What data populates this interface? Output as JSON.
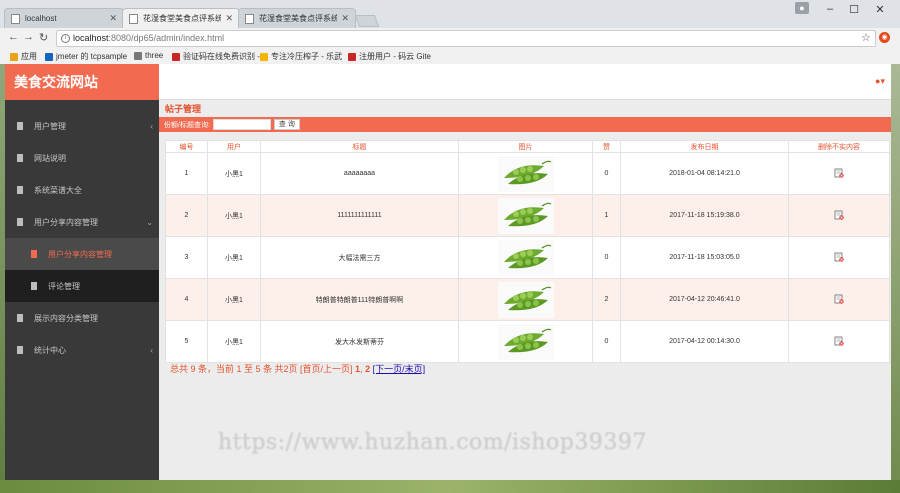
{
  "browser": {
    "tabs": [
      {
        "title": "localhost",
        "active": false
      },
      {
        "title": "花湿食堂美食点评系统",
        "active": true
      },
      {
        "title": "花湿食堂美食点评系统",
        "active": false
      }
    ],
    "url_host": "localhost",
    "url_path": ":8080/dp65/admin/index.html",
    "bookmarks": [
      "应用",
      "jmeter 的 tcpsample",
      "three",
      "验证码在线免费识别 -",
      "专注冷压榨子 - 乐武",
      "注册用户 - 码云 Gite"
    ],
    "bookmark_colors": [
      "#e8a317",
      "#1565c0",
      "#777777",
      "#c62828",
      "#f5b400",
      "#c62828"
    ]
  },
  "app": {
    "brand": "美食交流网站",
    "accent": "#f26b50",
    "sidebar": [
      {
        "label": "用户管理",
        "caret": "‹",
        "sub": false,
        "active": false
      },
      {
        "label": "网站说明",
        "caret": "",
        "sub": false,
        "active": false
      },
      {
        "label": "系统菜谱大全",
        "caret": "",
        "sub": false,
        "active": false
      },
      {
        "label": "用户分享内容管理",
        "caret": "⌄",
        "sub": false,
        "active": false
      },
      {
        "label": "用户分享内容管理",
        "caret": "",
        "sub": true,
        "active": true
      },
      {
        "label": "评论管理",
        "caret": "",
        "sub": true,
        "active": false
      },
      {
        "label": "展示内容分类管理",
        "caret": "",
        "sub": false,
        "active": false
      },
      {
        "label": "统计中心",
        "caret": "‹",
        "sub": false,
        "active": false
      }
    ],
    "section_title": "帖子管理",
    "search": {
      "label": "份额/标题查询:",
      "value": "",
      "button": "查 询"
    },
    "table": {
      "headers": [
        "编号",
        "用户",
        "标题",
        "图片",
        "赞",
        "发布日期",
        "删除不实内容"
      ],
      "rows": [
        {
          "id": "1",
          "user": "小黑1",
          "title": "aaaaaaaa",
          "likes": "0",
          "date": "2018-01-04 08:14:21.0"
        },
        {
          "id": "2",
          "user": "小黑1",
          "title": "1111111111111",
          "likes": "1",
          "date": "2017-11-18 15:19:38.0"
        },
        {
          "id": "3",
          "user": "小黑1",
          "title": "大幅法需三方",
          "likes": "0",
          "date": "2017-11-18 15:03:05.0"
        },
        {
          "id": "4",
          "user": "小黑1",
          "title": "特朗普特朗普111特朗普啊啊",
          "likes": "2",
          "date": "2017-04-12 20:46:41.0"
        },
        {
          "id": "5",
          "user": "小黑1",
          "title": "发大水发斯蒂芬",
          "likes": "0",
          "date": "2017-04-12 00:14:30.0"
        }
      ]
    },
    "pager": {
      "summary": "总共 9 条，当前 1 至 5 条 共2页 [首页/上一页]",
      "page1": "1",
      "page2": "2",
      "next": "[下一页/末页]"
    }
  },
  "watermark": "https://www.huzhan.com/ishop39397"
}
